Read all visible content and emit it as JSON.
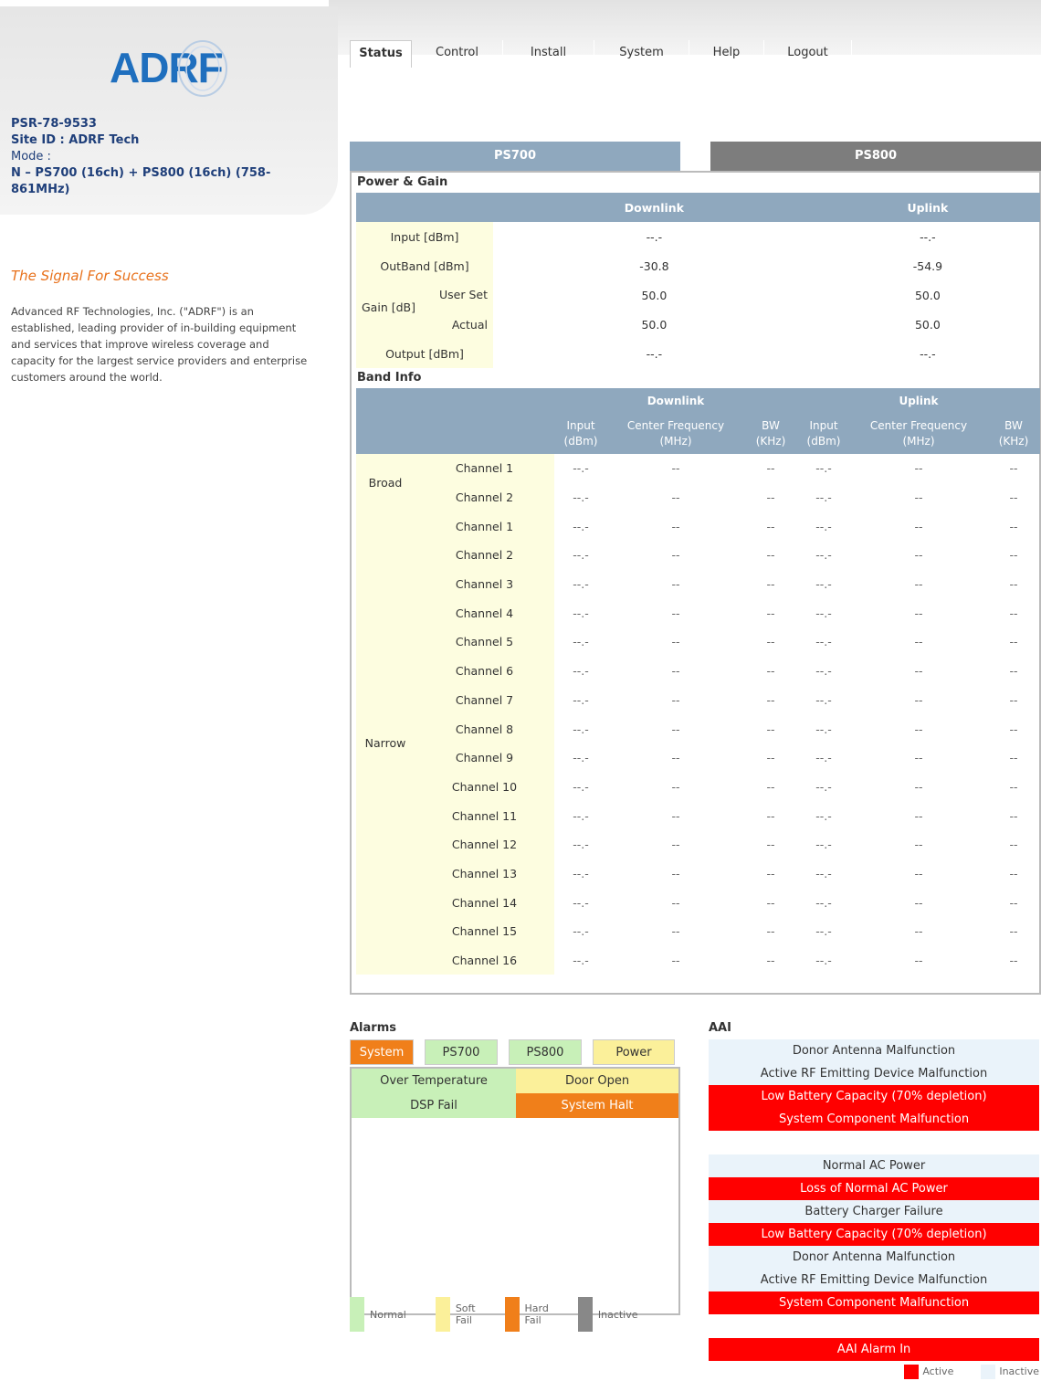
{
  "brand": {
    "logo_text": "ADRF"
  },
  "device": {
    "model": "PSR-78-9533",
    "site_id": "Site ID : ADRF Tech",
    "mode_label": "Mode :",
    "mode_value": "N – PS700 (16ch) + PS800 (16ch) (758-861MHz)"
  },
  "sidebar": {
    "tagline": "The Signal For Success",
    "about": "Advanced RF Technologies, Inc. (\"ADRF\") is an established, leading provider of in-building equipment and services that improve wireless coverage and capacity for the largest service providers and enterprise customers around the world."
  },
  "nav": {
    "tabs": [
      "Status",
      "Control",
      "Install",
      "System",
      "Help",
      "Logout"
    ],
    "active": "Status"
  },
  "band_tabs": [
    "PS700",
    "PS800"
  ],
  "power_gain": {
    "title": "Power & Gain",
    "columns": [
      "Downlink",
      "Uplink"
    ],
    "rows": [
      {
        "label": "Input [dBm]",
        "downlink": "--.-",
        "uplink": "--.-"
      },
      {
        "label": "OutBand [dBm]",
        "downlink": "-30.8",
        "uplink": "-54.9"
      },
      {
        "label": "Gain [dB]",
        "sub": "User Set",
        "downlink": "50.0",
        "uplink": "50.0"
      },
      {
        "label": "",
        "sub": "Actual",
        "downlink": "50.0",
        "uplink": "50.0"
      },
      {
        "label": "Output [dBm]",
        "downlink": "--.-",
        "uplink": "--.-"
      }
    ]
  },
  "band_info": {
    "title": "Band Info",
    "groups": [
      "Downlink",
      "Uplink"
    ],
    "subheaders": [
      "Input\n(dBm)",
      "Center Frequency\n(MHz)",
      "BW\n(KHz)"
    ],
    "row_groups": [
      {
        "label": "Broad",
        "channels": [
          "Channel 1",
          "Channel 2"
        ]
      },
      {
        "label": "Narrow",
        "channels": [
          "Channel 1",
          "Channel 2",
          "Channel 3",
          "Channel 4",
          "Channel 5",
          "Channel 6",
          "Channel 7",
          "Channel 8",
          "Channel 9",
          "Channel 10",
          "Channel 11",
          "Channel 12",
          "Channel 13",
          "Channel 14",
          "Channel 15",
          "Channel 16"
        ]
      }
    ],
    "input_placeholder": "--.-",
    "empty_placeholder": "--"
  },
  "alarms": {
    "title": "Alarms",
    "tabs": [
      "System",
      "PS700",
      "PS800",
      "Power"
    ],
    "active_tab": "System",
    "items": [
      {
        "label": "Over Temperature",
        "status": "normal",
        "color": "#c8f0b8"
      },
      {
        "label": "Door Open",
        "status": "soft",
        "color": "#fbf09a"
      },
      {
        "label": "DSP Fail",
        "status": "normal",
        "color": "#c8f0b8"
      },
      {
        "label": "System Halt",
        "status": "hard",
        "color": "#f07f1a"
      }
    ],
    "legend": [
      {
        "label": "Normal",
        "color": "#c8f0b8"
      },
      {
        "label": "Soft\nFail",
        "color": "#fbf09a"
      },
      {
        "label": "Hard\nFail",
        "color": "#f07f1a"
      },
      {
        "label": "Inactive",
        "color": "#888888"
      }
    ]
  },
  "aai": {
    "title": "AAI",
    "groups": [
      [
        {
          "label": "Donor Antenna Malfunction",
          "state": "inactive"
        },
        {
          "label": "Active RF Emitting Device Malfunction",
          "state": "inactive"
        },
        {
          "label": "Low Battery Capacity (70% depletion)",
          "state": "active"
        },
        {
          "label": "System Component Malfunction",
          "state": "active"
        }
      ],
      [
        {
          "label": "Normal AC Power",
          "state": "inactive"
        },
        {
          "label": "Loss of Normal AC Power",
          "state": "active"
        },
        {
          "label": "Battery Charger Failure",
          "state": "inactive"
        },
        {
          "label": "Low Battery Capacity (70% depletion)",
          "state": "active"
        },
        {
          "label": "Donor Antenna Malfunction",
          "state": "inactive"
        },
        {
          "label": "Active RF Emitting Device Malfunction",
          "state": "inactive"
        },
        {
          "label": "System Component Malfunction",
          "state": "active"
        }
      ],
      [
        {
          "label": "AAI Alarm In",
          "state": "active"
        }
      ]
    ],
    "legend": [
      {
        "label": "Active",
        "color": "#ff0000"
      },
      {
        "label": "Inactive",
        "color": "#eaf3fa"
      }
    ]
  }
}
